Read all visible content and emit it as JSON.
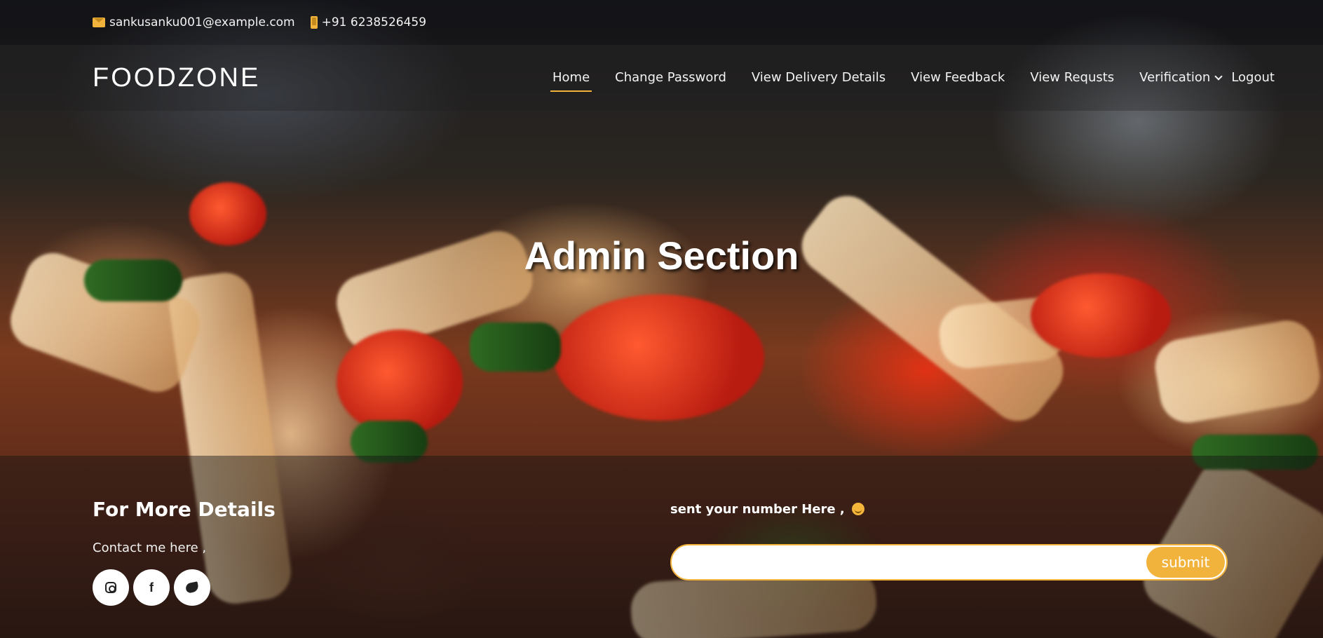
{
  "topbar": {
    "email": "sankusanku001@example.com",
    "phone": "+91 6238526459",
    "email_icon": "envelope-icon",
    "phone_icon": "mobile-phone-icon"
  },
  "brand": {
    "name": "FOODZONE"
  },
  "nav": {
    "home": "Home",
    "change_password": "Change Password",
    "view_delivery_details": "View Delivery Details",
    "view_feedback": "View Feedback",
    "view_requests": "View Requsts",
    "verification": "Verification",
    "logout": "Logout"
  },
  "hero": {
    "title": "Admin Section"
  },
  "footer": {
    "heading": "For More Details",
    "contact_text": "Contact me here ,",
    "socials": [
      "instagram-icon",
      "facebook-icon",
      "twitter-icon"
    ],
    "newsletter_label": "sent your number Here ,",
    "input_value": "",
    "submit_label": "submit"
  },
  "colors": {
    "accent": "#f2b33d",
    "text": "#ffffff"
  }
}
